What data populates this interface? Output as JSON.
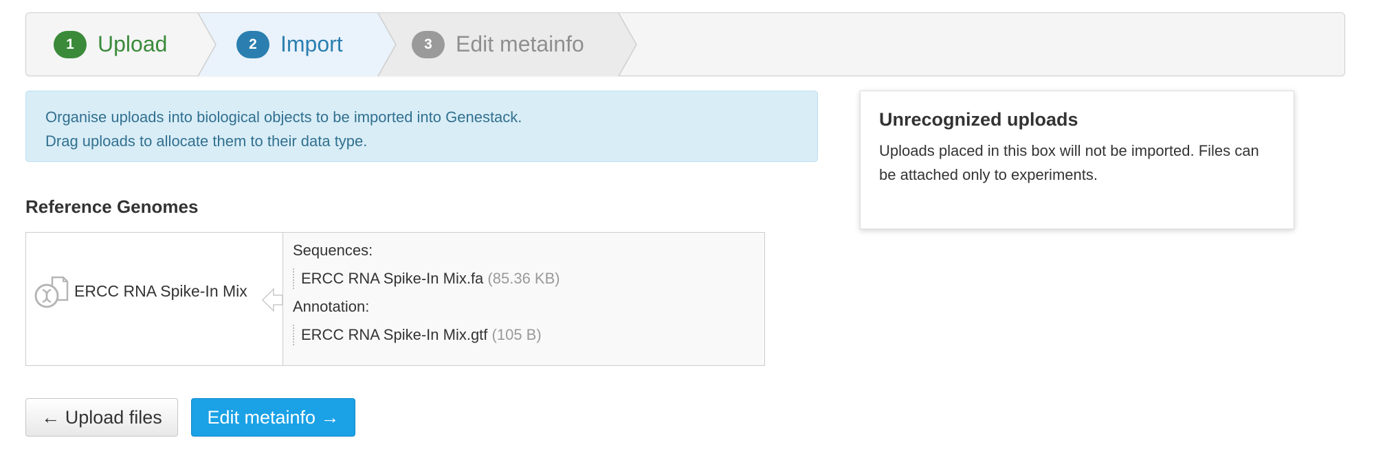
{
  "wizard": {
    "steps": [
      {
        "number": "1",
        "label": "Upload",
        "state": "done",
        "color": "#3a8a3a"
      },
      {
        "number": "2",
        "label": "Import",
        "state": "active",
        "color": "#2a7fb0"
      },
      {
        "number": "3",
        "label": "Edit metainfo",
        "state": "pending",
        "color": "#9a9a9a"
      }
    ]
  },
  "info": {
    "line1": "Organise uploads into biological objects to be imported into Genestack.",
    "line2": "Drag uploads to allocate them to their data type."
  },
  "reference_genomes": {
    "title": "Reference Genomes",
    "items": [
      {
        "icon": "genome-file-icon",
        "name": "ERCC RNA Spike-In Mix",
        "sequences_label": "Sequences:",
        "sequences": [
          {
            "file": "ERCC RNA Spike-In Mix.fa",
            "size": "(85.36 KB)"
          }
        ],
        "annotation_label": "Annotation:",
        "annotations": [
          {
            "file": "ERCC RNA Spike-In Mix.gtf",
            "size": "(105 B)"
          }
        ]
      }
    ]
  },
  "unrecognized": {
    "title": "Unrecognized uploads",
    "text": "Uploads placed in this box will not be imported. Files can be attached only to experiments."
  },
  "buttons": {
    "back_label": "← Upload files",
    "next_label": "Edit metainfo →"
  }
}
